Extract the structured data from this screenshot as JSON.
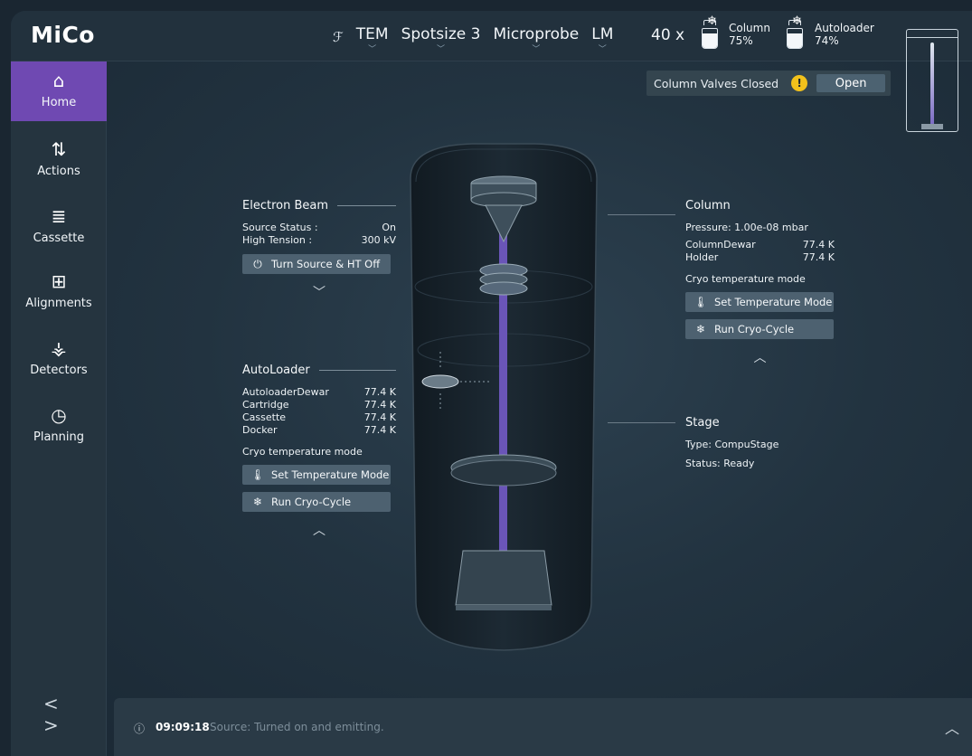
{
  "app": {
    "title": "MiCo"
  },
  "topbar": {
    "modes": [
      "TEM",
      "Spotsize 3",
      "Microprobe",
      "LM"
    ],
    "magnification": "40 x",
    "column_level": {
      "label": "Column",
      "value": "75%",
      "fraction": 0.75
    },
    "autoloader_level": {
      "label": "Autoloader",
      "value": "74%",
      "fraction": 0.74
    }
  },
  "sidebar": {
    "items": [
      {
        "label": "Home",
        "icon": "home-icon"
      },
      {
        "label": "Actions",
        "icon": "refresh-icon"
      },
      {
        "label": "Cassette",
        "icon": "cassette-icon"
      },
      {
        "label": "Alignments",
        "icon": "alignment-icon"
      },
      {
        "label": "Detectors",
        "icon": "detector-icon"
      },
      {
        "label": "Planning",
        "icon": "clock-icon"
      }
    ],
    "pager": "< >"
  },
  "valves": {
    "status": "Column Valves Closed",
    "button": "Open"
  },
  "electron_beam": {
    "title": "Electron Beam",
    "source_status_label": "Source Status :",
    "source_status_value": "On",
    "high_tension_label": "High Tension :",
    "high_tension_value": "300 kV",
    "button": "Turn Source & HT Off"
  },
  "autoloader": {
    "title": "AutoLoader",
    "rows": [
      {
        "label": "AutoloaderDewar",
        "value": "77.4 K"
      },
      {
        "label": "Cartridge",
        "value": "77.4 K"
      },
      {
        "label": "Cassette",
        "value": "77.4 K"
      },
      {
        "label": "Docker",
        "value": "77.4 K"
      }
    ],
    "mode_label": "Cryo temperature mode",
    "set_mode_button": "Set Temperature Mode",
    "cryo_cycle_button": "Run Cryo-Cycle"
  },
  "column": {
    "title": "Column",
    "pressure": "Pressure: 1.00e-08 mbar",
    "rows": [
      {
        "label": "ColumnDewar",
        "value": "77.4 K"
      },
      {
        "label": "Holder",
        "value": "77.4 K"
      }
    ],
    "mode_label": "Cryo temperature mode",
    "set_mode_button": "Set Temperature Mode",
    "cryo_cycle_button": "Run Cryo-Cycle"
  },
  "stage": {
    "title": "Stage",
    "type_label": "Type:",
    "type_value": "CompuStage",
    "status_label": "Status:",
    "status_value": "Ready"
  },
  "status_bar": {
    "time": "09:09:18",
    "message": "Source: Turned on and emitting."
  },
  "colors": {
    "accent": "#6f49b2",
    "warning": "#f2c11b",
    "beam": "#6a55b8"
  }
}
